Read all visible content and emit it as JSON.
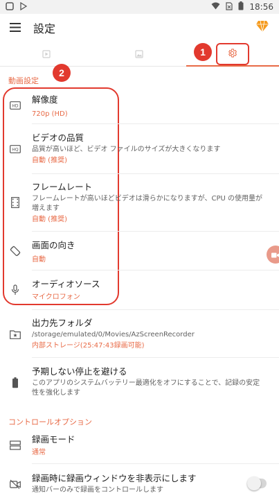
{
  "status_bar": {
    "time": "18:56"
  },
  "app_bar": {
    "title": "設定"
  },
  "tabs": [
    {
      "icon": "video-icon"
    },
    {
      "icon": "image-icon"
    },
    {
      "icon": "gear-icon"
    }
  ],
  "annotations": {
    "marker1": "1",
    "marker2": "2"
  },
  "sections": {
    "video_settings": "動画設定",
    "control_options": "コントロールオプション"
  },
  "settings": {
    "resolution": {
      "title": "解像度",
      "value": "720p (HD)"
    },
    "video_quality": {
      "title": "ビデオの品質",
      "desc": "品質が高いほど、ビデオ ファイルのサイズが大きくなります",
      "value": "自動 (推奨)"
    },
    "frame_rate": {
      "title": "フレームレート",
      "desc": "フレームレートが高いほどビデオは滑らかになりますが、CPU の使用量が増えます",
      "value": "自動 (推奨)"
    },
    "orientation": {
      "title": "画面の向き",
      "value": "自動"
    },
    "audio_source": {
      "title": "オーディオソース",
      "value": "マイクロフォン"
    },
    "output_folder": {
      "title": "出力先フォルダ",
      "desc": "/storage/emulated/0/Movies/AzScreenRecorder",
      "value": "内部ストレージ(25:47:43録画可能)"
    },
    "avoid_stop": {
      "title": "予期しない停止を避ける",
      "desc": "このアプリのシステムバッテリー最適化をオフにすることで、記録の安定性を強化します"
    },
    "record_mode": {
      "title": "録画モード",
      "value": "通常"
    },
    "hide_window": {
      "title": "録画時に録画ウィンドウを非表示にします",
      "desc": "通知バーのみで録画をコントロールします",
      "enabled": false
    }
  },
  "colors": {
    "accent": "#e86a46",
    "annotation": "#e2392e"
  }
}
